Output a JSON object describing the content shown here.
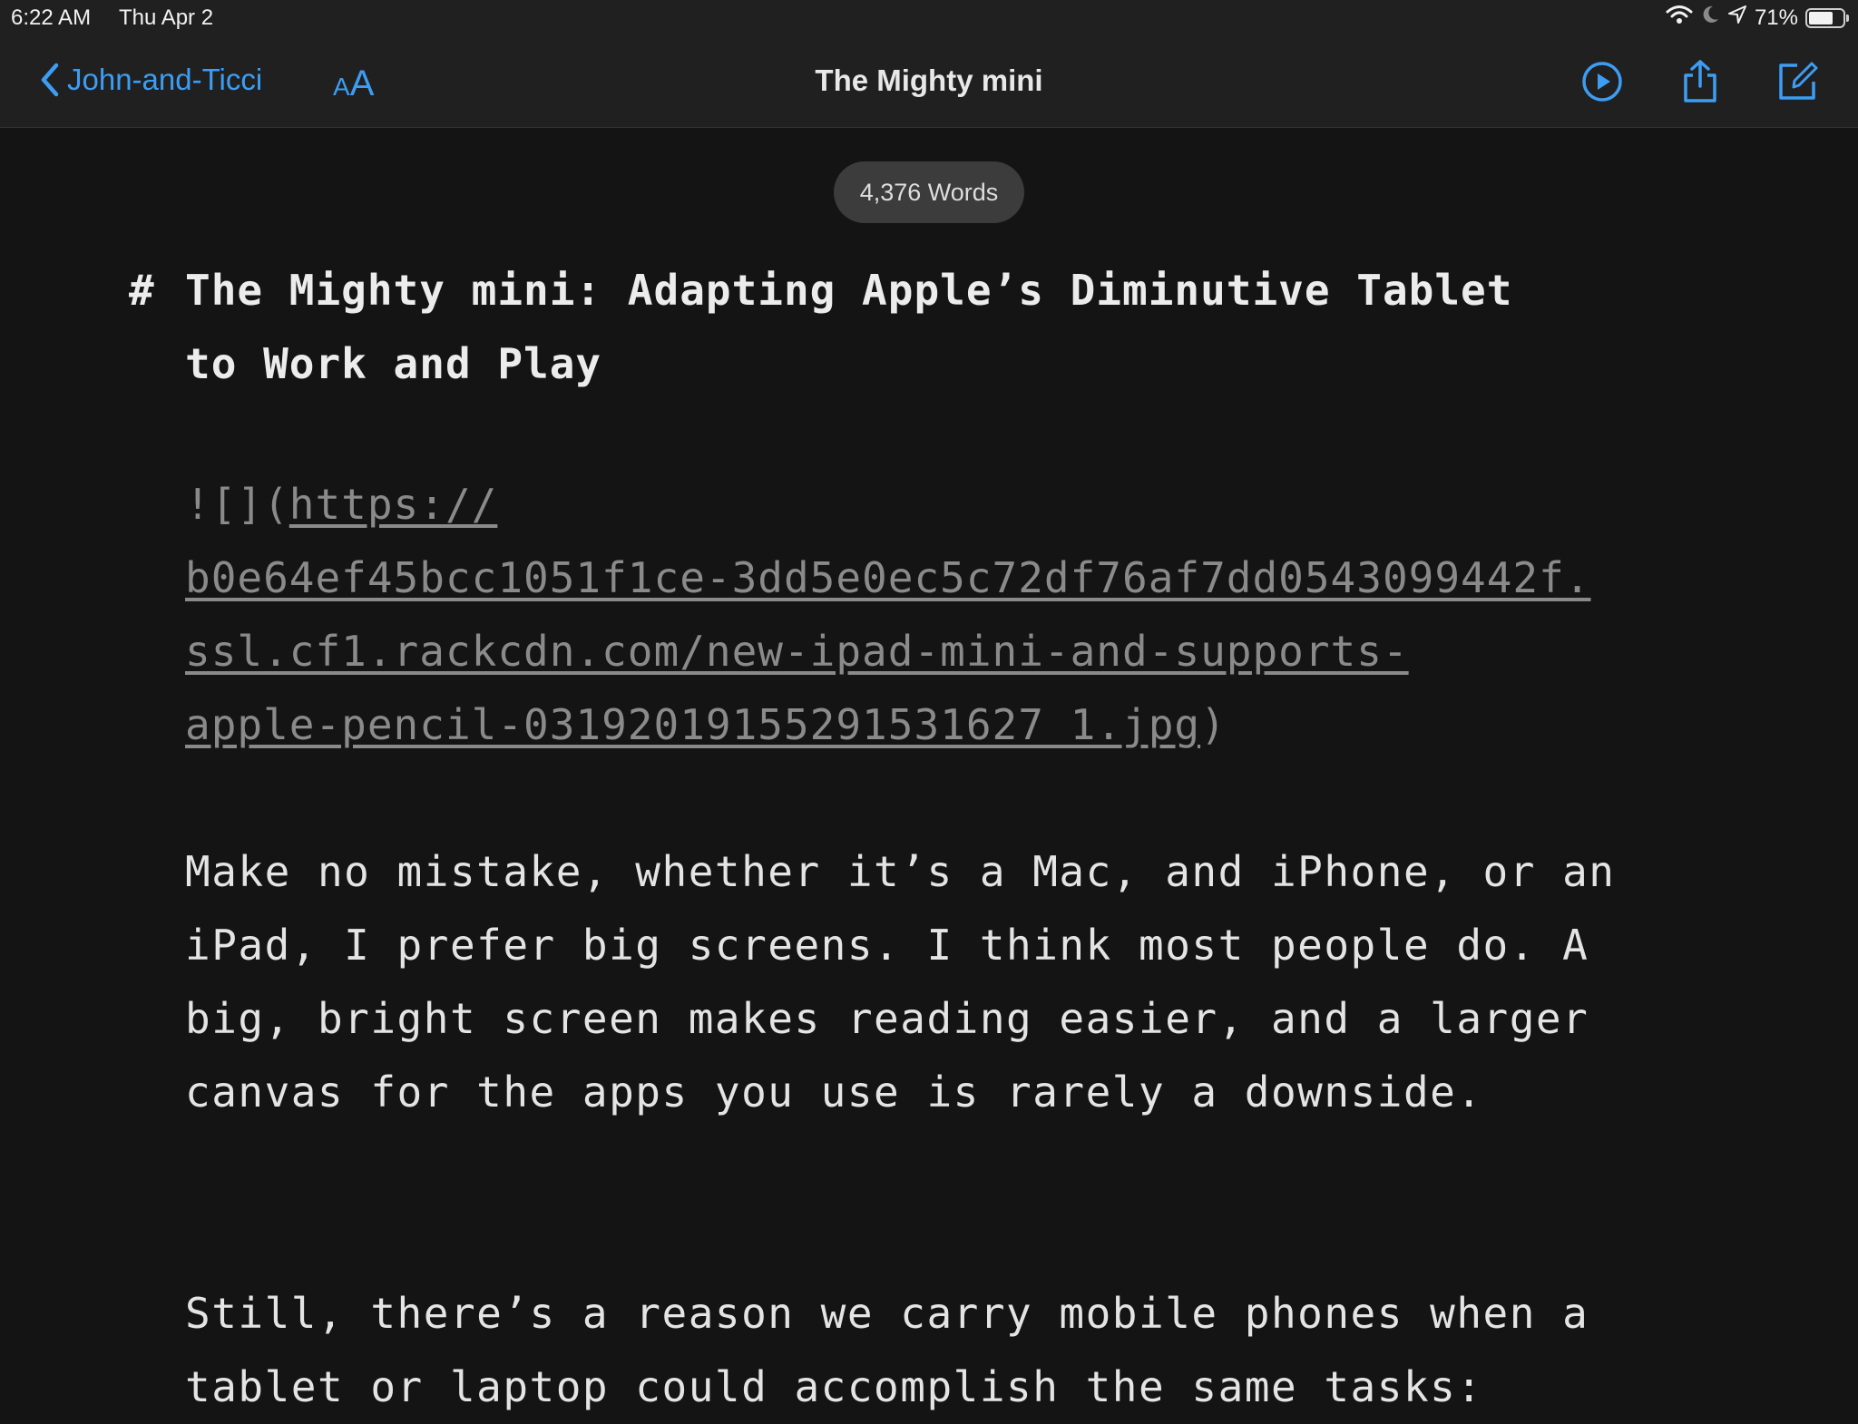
{
  "status_bar": {
    "time": "6:22 AM",
    "date": "Thu Apr 2",
    "battery_percent": "71%",
    "battery_level": 0.71,
    "icons": [
      "wifi-icon",
      "moon-icon",
      "location-icon",
      "battery-icon"
    ]
  },
  "nav": {
    "back_label": "John-and-Ticci",
    "text_size_small": "A",
    "text_size_big": "A",
    "title": "The Mighty mini",
    "icons": [
      "chevron-left-icon",
      "play-icon",
      "share-icon",
      "compose-icon"
    ]
  },
  "word_count": "4,376 Words",
  "document": {
    "heading_marker": "#",
    "heading_line1": "The Mighty mini: Adapting Apple’s Diminutive Tablet",
    "heading_line2": "to Work and Play",
    "image_prefix": "![](",
    "image_url_line1": "https://",
    "image_url_line2": "b0e64ef45bcc1051f1ce-3dd5e0ec5c72df76af7dd0543099442f.",
    "image_url_line3": "ssl.cf1.rackcdn.com/new-ipad-mini-and-supports-",
    "image_url_line4": "apple-pencil-03192019155291531627 1.jpg",
    "image_suffix": ")",
    "paragraph1": "Make no mistake, whether it’s a Mac, and iPhone, or an iPad, I prefer big screens. I think most people do. A big, bright screen makes reading easier, and a larger canvas for the apps you use is rarely a downside.",
    "paragraph2": "Still, there’s a reason we carry mobile phones when a tablet or laptop could accomplish the same tasks:"
  },
  "colors": {
    "accent": "#3d9df3",
    "background": "#141414",
    "bar": "#202020"
  }
}
